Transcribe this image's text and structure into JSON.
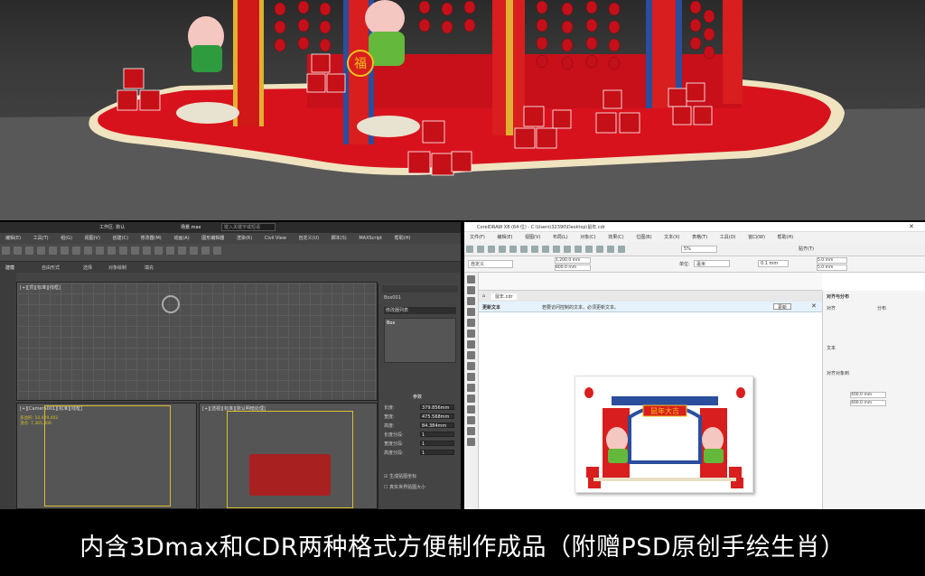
{
  "render": {
    "fu_char": "福",
    "cube_chars": [
      "福"
    ]
  },
  "max": {
    "title": "场景.max",
    "search_placeholder": "键入关键字或短语",
    "workspace": "工作区: 默认",
    "menu": [
      "编辑(E)",
      "工具(T)",
      "组(G)",
      "视图(V)",
      "创建(C)",
      "修改器(M)",
      "动画(A)",
      "图形编辑器",
      "渲染(R)",
      "Civil View",
      "自定义(U)",
      "脚本(S)",
      "MAXScript",
      "帮助(H)"
    ],
    "ribbon_tabs": [
      "建模",
      "自由形式",
      "选择",
      "对象绘制",
      "填充"
    ],
    "vp_top_label": "[+][顶][标准][线框]",
    "vp_front_label": "[+][Camera001][标准][线框]",
    "vp_persp_label": "[+][透视][标准][默认明暗处理]",
    "stats": [
      "多边形:",
      "顶点:"
    ],
    "stats_values": [
      "10,429,402",
      "7,365,308"
    ],
    "cmd_object": "Box001",
    "cmd_modifier": "修改器列表",
    "cmd_stack_item": "Box",
    "params_title": "参数",
    "params": [
      {
        "label": "长度:",
        "value": "379.856mm"
      },
      {
        "label": "宽度:",
        "value": "475.568mm"
      },
      {
        "label": "高度:",
        "value": "84.384mm"
      },
      {
        "label": "长度分段:",
        "value": "1"
      },
      {
        "label": "宽度分段:",
        "value": "1"
      },
      {
        "label": "高度分段:",
        "value": "1"
      }
    ],
    "checkbox_1": "生成贴图坐标",
    "checkbox_2": "真实世界贴图大小"
  },
  "cdr": {
    "title": "CorelDRAW X8 (64 位) - C:\\Users\\32390\\Desktop\\鼠年.cdr",
    "menu": [
      "文件(F)",
      "编辑(E)",
      "视图(V)",
      "布局(L)",
      "对象(C)",
      "效果(C)",
      "位图(B)",
      "文本(X)",
      "表格(T)",
      "工具(O)",
      "窗口(W)",
      "帮助(H)"
    ],
    "zoom": "5%",
    "snap": "贴齐(T)",
    "paper_size": "自定义",
    "width": "1,200.0 mm",
    "height": "800.0 mm",
    "units_label": "单位:",
    "units": "毫米",
    "nudge": "0.1 mm",
    "dup_x": "5.0 mm",
    "dup_y": "5.0 mm",
    "doc_tab": "鼠年.cdr",
    "notify_title": "更新文本",
    "notify_msg": "若要访问控制的文本，必须更新文本。",
    "update_button": "更新",
    "panel_title": "对齐与分布",
    "panel_sections": [
      "对齐",
      "分布",
      "文本",
      "对齐对象到"
    ],
    "panel_values": [
      "400.0 mm",
      "400.0 mm"
    ],
    "sign_text": "鼠年大吉"
  },
  "caption": "内含3Dmax和CDR两种格式方便制作成品（附赠PSD原创手绘生肖）",
  "colors": {
    "red": "#d81e1e",
    "gold": "#f2c018",
    "blue": "#2a4d9c",
    "caption_bg": "#000000"
  }
}
